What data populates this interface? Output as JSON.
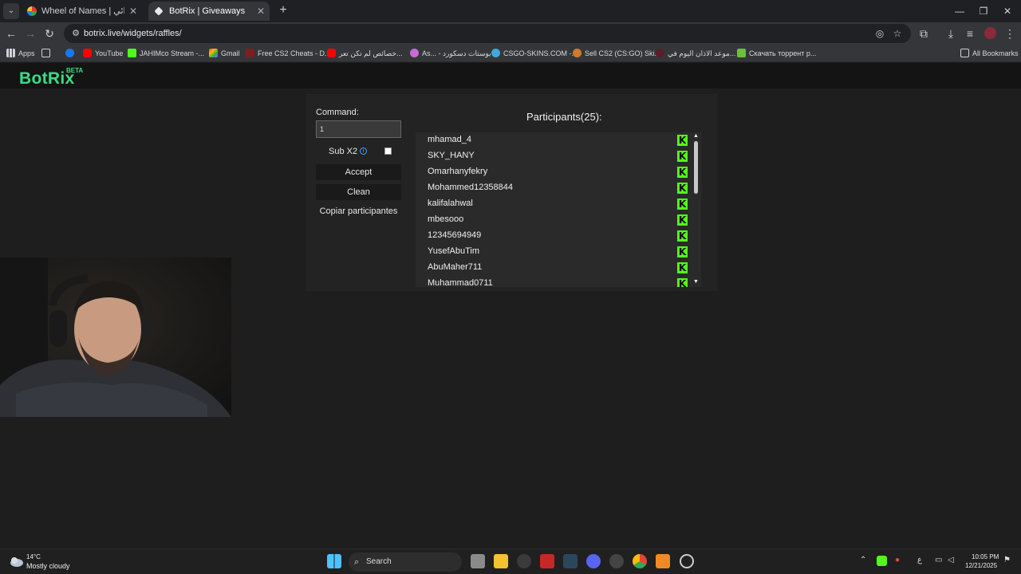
{
  "browser": {
    "tabs": [
      {
        "title": "Wheel of Names | اسم العشوائي",
        "active": false
      },
      {
        "title": "BotRix | Giveaways",
        "active": true
      }
    ],
    "url": "botrix.live/widgets/raffles/",
    "bookmarks": [
      {
        "label": "Apps"
      },
      {
        "label": "YouTube"
      },
      {
        "label": "JAHIMco Stream -..."
      },
      {
        "label": "Gmail"
      },
      {
        "label": "Free CS2 Cheats - D..."
      },
      {
        "label": "خصائص لم تكن تعر..."
      },
      {
        "label": "As... - بوستات دسكورد"
      },
      {
        "label": "CSGO-SKINS.COM -..."
      },
      {
        "label": "Sell CS2 (CS:GO) Ski..."
      },
      {
        "label": "موعد الاذان اليوم في..."
      },
      {
        "label": "Скачать торрент р..."
      }
    ],
    "all_bookmarks": "All Bookmarks"
  },
  "site": {
    "logo": "BotRix",
    "beta": "BETA"
  },
  "raffle": {
    "command_label": "Command:",
    "command_value": "1",
    "sub_label": "Sub X2",
    "sub_checked": false,
    "accept_label": "Accept",
    "clean_label": "Clean",
    "copy_label": "Copiar participantes",
    "participants_title": "Participants(25):",
    "participants": [
      "mhamad_4",
      "SKY_HANY",
      "Omarhanyfekry",
      "Mohammed12358844",
      "kalifalahwal",
      "mbesooo",
      "12345694949",
      "YusefAbuTim",
      "AbuMaher711",
      "Muhammad0711"
    ]
  },
  "taskbar": {
    "temperature": "14°C",
    "weather": "Mostly cloudy",
    "search_label": "Search",
    "ime": "ع",
    "time": "10:05 PM",
    "date": "12/21/2025"
  },
  "colors": {
    "accent_green": "#3ddc84",
    "kick_green": "#53fc18"
  }
}
